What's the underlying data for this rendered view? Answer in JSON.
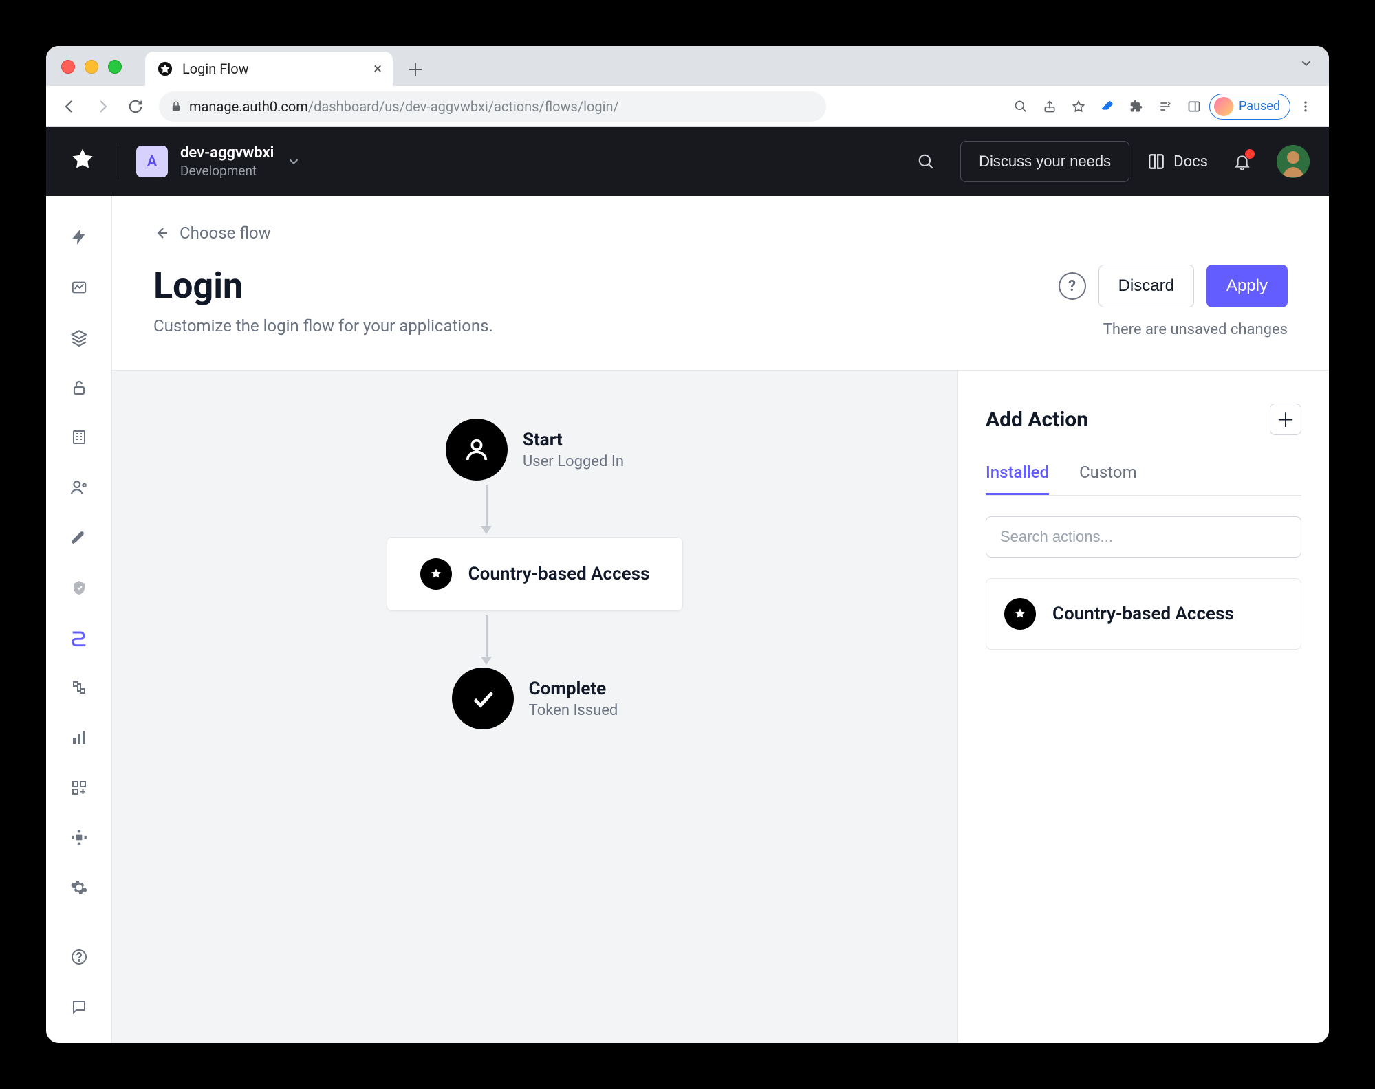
{
  "browser": {
    "tab_title": "Login Flow",
    "url_host": "manage.auth0.com",
    "url_path": "/dashboard/us/dev-aggvwbxi/actions/flows/login/",
    "profile_label": "Paused"
  },
  "header": {
    "tenant_initial": "A",
    "tenant_name": "dev-aggvwbxi",
    "tenant_env": "Development",
    "discuss_label": "Discuss your needs",
    "docs_label": "Docs"
  },
  "page": {
    "breadcrumb": "Choose flow",
    "title": "Login",
    "subtitle": "Customize the login flow for your applications.",
    "discard_label": "Discard",
    "apply_label": "Apply",
    "unsaved_text": "There are unsaved changes"
  },
  "flow": {
    "start_title": "Start",
    "start_sub": "User Logged In",
    "action_label": "Country-based Access",
    "complete_title": "Complete",
    "complete_sub": "Token Issued"
  },
  "right_panel": {
    "title": "Add Action",
    "tabs": {
      "installed": "Installed",
      "custom": "Custom"
    },
    "search_placeholder": "Search actions...",
    "installed_action": "Country-based Access"
  }
}
